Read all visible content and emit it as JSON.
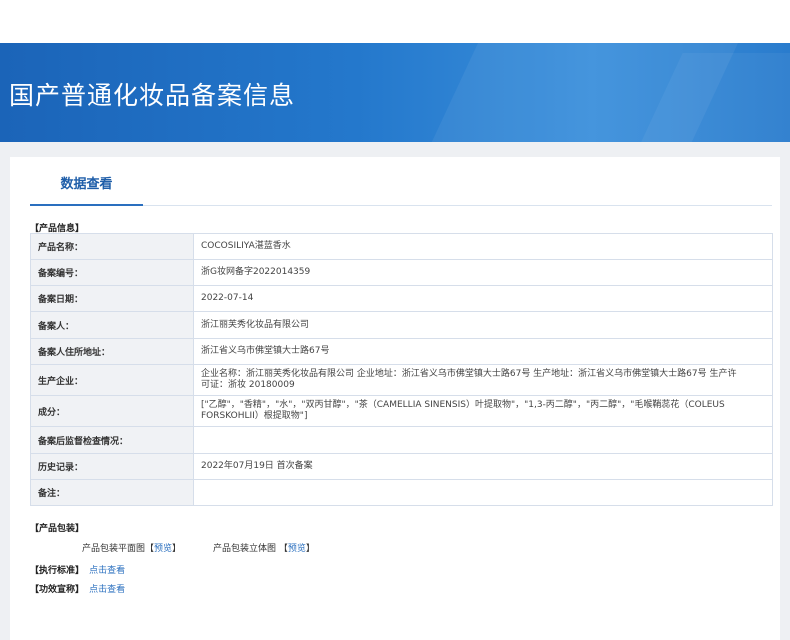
{
  "header": {
    "title": "国产普通化妆品备案信息"
  },
  "tab": {
    "label": "数据查看"
  },
  "product_info": {
    "section_label": "【产品信息】",
    "rows": [
      {
        "key": "产品名称：",
        "value": "COCOSILIYA湛蓝香水"
      },
      {
        "key": "备案编号：",
        "value": "浙G妆网备字2022014359"
      },
      {
        "key": "备案日期：",
        "value": "2022-07-14"
      },
      {
        "key": "备案人：",
        "value": "浙江丽芙秀化妆品有限公司"
      },
      {
        "key": "备案人住所地址：",
        "value": "浙江省义乌市佛堂镇大士路67号"
      },
      {
        "key": "生产企业：",
        "value": "企业名称：浙江丽芙秀化妆品有限公司 企业地址：浙江省义乌市佛堂镇大士路67号 生产地址：浙江省义乌市佛堂镇大士路67号 生产许可证：浙妆 20180009"
      },
      {
        "key": "成分：",
        "value": "[\"乙醇\"，\"香精\"，\"水\"，\"双丙甘醇\"，\"茶（CAMELLIA SINENSIS）叶提取物\"，\"1,3-丙二醇\"，\"丙二醇\"，\"毛喉鞘蕊花（COLEUS FORSKOHLII）根提取物\"]"
      },
      {
        "key": "备案后监督检查情况：",
        "value": ""
      },
      {
        "key": "历史记录：",
        "value": "2022年07月19日 首次备案"
      },
      {
        "key": "备注：",
        "value": ""
      }
    ]
  },
  "packaging": {
    "section_label": "【产品包装】",
    "flat_label": "产品包装平面图",
    "flat_bracket_open": "【",
    "flat_link": "预览",
    "flat_bracket_close": "】",
    "solid_label": "产品包装立体图",
    "solid_bracket_open": "【",
    "solid_link": "预览",
    "solid_bracket_close": "】"
  },
  "standard": {
    "label": "【执行标准】",
    "link": "点击查看"
  },
  "efficacy": {
    "label": "【功效宣称】",
    "link": "点击查看"
  },
  "colors": {
    "header": "#2478cc",
    "accent": "#2a6fbf",
    "label_bg": "#f0f2f5"
  }
}
